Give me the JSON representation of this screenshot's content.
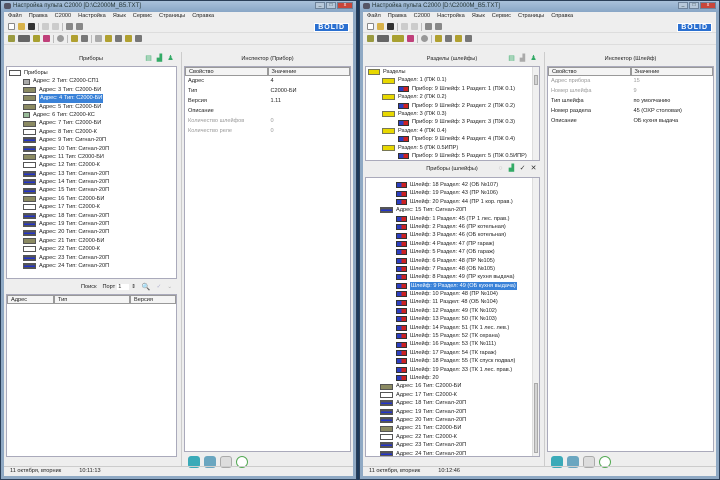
{
  "left": {
    "title": "Настройка пульта С2000 [D:\\C2000M_B5.TXT]",
    "menu": [
      "Файл",
      "Правка",
      "С2000",
      "Настройка",
      "Язык",
      "Сервис",
      "Страницы",
      "Справка"
    ],
    "logo": "BOLID",
    "devices_panel": {
      "title": "Приборы",
      "root": "Приборы",
      "items": [
        {
          "label": "Адрес: 2 Тип: С2000-СП1",
          "icon": "gray"
        },
        {
          "label": "Адрес: 3 Тип: С2000-БИ",
          "icon": "bi"
        },
        {
          "label": "Адрес: 4 Тип: С2000-БИ",
          "icon": "bi",
          "selected": true
        },
        {
          "label": "Адрес: 5 Тип: С2000-БИ",
          "icon": "bi"
        },
        {
          "label": "Адрес: 6 Тип: С2000-КС",
          "icon": "kc"
        },
        {
          "label": "Адрес: 7 Тип: С2000-БИ",
          "icon": "bi"
        },
        {
          "label": "Адрес: 8 Тип: С2000-К",
          "icon": "k"
        },
        {
          "label": "Адрес: 9 Тип: Сигнал-20П",
          "icon": "sig"
        },
        {
          "label": "Адрес: 10 Тип: Сигнал-20П",
          "icon": "sig"
        },
        {
          "label": "Адрес: 11 Тип: С2000-БИ",
          "icon": "bi"
        },
        {
          "label": "Адрес: 12 Тип: С2000-К",
          "icon": "k"
        },
        {
          "label": "Адрес: 13 Тип: Сигнал-20П",
          "icon": "sig"
        },
        {
          "label": "Адрес: 14 Тип: Сигнал-20П",
          "icon": "sig"
        },
        {
          "label": "Адрес: 15 Тип: Сигнал-20П",
          "icon": "sig"
        },
        {
          "label": "Адрес: 16 Тип: С2000-БИ",
          "icon": "bi"
        },
        {
          "label": "Адрес: 17 Тип: С2000-К",
          "icon": "k"
        },
        {
          "label": "Адрес: 18 Тип: Сигнал-20П",
          "icon": "sig"
        },
        {
          "label": "Адрес: 19 Тип: Сигнал-20П",
          "icon": "sig"
        },
        {
          "label": "Адрес: 20 Тип: Сигнал-20П",
          "icon": "sig"
        },
        {
          "label": "Адрес: 21 Тип: С2000-БИ",
          "icon": "bi"
        },
        {
          "label": "Адрес: 22 Тип: С2000-К",
          "icon": "k"
        },
        {
          "label": "Адрес: 23 Тип: Сигнал-20П",
          "icon": "sig"
        },
        {
          "label": "Адрес: 24 Тип: Сигнал-20П",
          "icon": "sig"
        }
      ]
    },
    "search": {
      "label": "Поиск",
      "port_label": "Порт",
      "port_value": "1",
      "columns": [
        "Адрес",
        "Тип",
        "Версия"
      ]
    },
    "inspector": {
      "title": "Инспектор (Прибор)",
      "col_prop": "Свойство",
      "col_val": "Значение",
      "rows": [
        {
          "p": "Адрес",
          "v": "4"
        },
        {
          "p": "Тип",
          "v": "С2000-БИ"
        },
        {
          "p": "Версия",
          "v": "1.11"
        },
        {
          "p": "Описание",
          "v": ""
        },
        {
          "p": "Количество шлейфов",
          "v": "0",
          "dim": true
        },
        {
          "p": "Количество реле",
          "v": "0",
          "dim": true
        }
      ]
    },
    "status": {
      "date": "11 октября, вторник",
      "time": "10:11:13"
    }
  },
  "right": {
    "title": "Настройка пульта С2000 [D:\\C2000M_B5.TXT]",
    "menu": [
      "Файл",
      "Правка",
      "С2000",
      "Настройка",
      "Язык",
      "Сервис",
      "Страницы",
      "Справка"
    ],
    "logo": "BOLID",
    "sections_panel": {
      "title": "Разделы (шлейфы)",
      "root": "Разделы",
      "items": [
        {
          "label": "Раздел: 1 (ПЖ 0.1)",
          "lvl": 1,
          "icon": "part"
        },
        {
          "label": "Прибор: 9 Шлейф: 1 Раздел: 1 (ПЖ 0.1)",
          "lvl": 2,
          "icon": "sh"
        },
        {
          "label": "Раздел: 2 (ПЖ 0.2)",
          "lvl": 1,
          "icon": "part"
        },
        {
          "label": "Прибор: 9 Шлейф: 2 Раздел: 2 (ПЖ 0.2)",
          "lvl": 2,
          "icon": "sh"
        },
        {
          "label": "Раздел: 3 (ПЖ 0.3)",
          "lvl": 1,
          "icon": "part"
        },
        {
          "label": "Прибор: 9 Шлейф: 3 Раздел: 3 (ПЖ 0.3)",
          "lvl": 2,
          "icon": "sh"
        },
        {
          "label": "Раздел: 4 (ПЖ 0.4)",
          "lvl": 1,
          "icon": "part"
        },
        {
          "label": "Прибор: 9 Шлейф: 4 Раздел: 4 (ПЖ 0.4)",
          "lvl": 2,
          "icon": "sh"
        },
        {
          "label": "Раздел: 5 (ПЖ 0.5ИПР)",
          "lvl": 1,
          "icon": "part"
        },
        {
          "label": "Прибор: 9 Шлейф: 5 Раздел: 5 (ПЖ 0.5ИПР)",
          "lvl": 2,
          "icon": "sh"
        }
      ]
    },
    "devices_panel": {
      "title": "Приборы (шлейфы)",
      "items": [
        {
          "label": "Шлейф: 18 Раздел: 42 (ОБ №107)",
          "lvl": 2,
          "icon": "sh"
        },
        {
          "label": "Шлейф: 19 Раздел: 43 (ПР №106)",
          "lvl": 2,
          "icon": "sh"
        },
        {
          "label": "Шлейф: 20 Раздел: 44 (ПР 1 кор. прав.)",
          "lvl": 2,
          "icon": "sh"
        },
        {
          "label": "Адрес: 15 Тип: Сигнал-20П",
          "lvl": 1,
          "icon": "sig"
        },
        {
          "label": "Шлейф: 1 Раздел: 45 (ТР 1 лес. прав.)",
          "lvl": 2,
          "icon": "sh"
        },
        {
          "label": "Шлейф: 2 Раздел: 46 (ПР котельная)",
          "lvl": 2,
          "icon": "sh"
        },
        {
          "label": "Шлейф: 3 Раздел: 46 (ОБ котельная)",
          "lvl": 2,
          "icon": "sh"
        },
        {
          "label": "Шлейф: 4 Раздел: 47 (ПР гараж)",
          "lvl": 2,
          "icon": "sh"
        },
        {
          "label": "Шлейф: 5 Раздел: 47 (ОБ гараж)",
          "lvl": 2,
          "icon": "sh"
        },
        {
          "label": "Шлейф: 6 Раздел: 48 (ПР №105)",
          "lvl": 2,
          "icon": "sh"
        },
        {
          "label": "Шлейф: 7 Раздел: 48 (ОБ №105)",
          "lvl": 2,
          "icon": "sh"
        },
        {
          "label": "Шлейф: 8 Раздел: 49 (ПР кухня выдача)",
          "lvl": 2,
          "icon": "sh"
        },
        {
          "label": "Шлейф: 9 Раздел: 49 (ОБ кухня выдача)",
          "lvl": 2,
          "icon": "sh",
          "selected": true
        },
        {
          "label": "Шлейф: 10 Раздел: 48 (ПР №104)",
          "lvl": 2,
          "icon": "sh"
        },
        {
          "label": "Шлейф: 11 Раздел: 48 (ОБ №104)",
          "lvl": 2,
          "icon": "sh"
        },
        {
          "label": "Шлейф: 12 Раздел: 49 (ТК №102)",
          "lvl": 2,
          "icon": "sh"
        },
        {
          "label": "Шлейф: 13 Раздел: 50 (ТК №103)",
          "lvl": 2,
          "icon": "sh"
        },
        {
          "label": "Шлейф: 14 Раздел: 51 (ТК 1 лес. лев.)",
          "lvl": 2,
          "icon": "sh"
        },
        {
          "label": "Шлейф: 15 Раздел: 52 (ТК охрана)",
          "lvl": 2,
          "icon": "sh"
        },
        {
          "label": "Шлейф: 16 Раздел: 53 (ТК №111)",
          "lvl": 2,
          "icon": "sh"
        },
        {
          "label": "Шлейф: 17 Раздел: 54 (ТК гараж)",
          "lvl": 2,
          "icon": "sh"
        },
        {
          "label": "Шлейф: 18 Раздел: 55 (ТК спуск подвал)",
          "lvl": 2,
          "icon": "sh"
        },
        {
          "label": "Шлейф: 19 Раздел: 33 (ТК 1 лес. прав.)",
          "lvl": 2,
          "icon": "sh"
        },
        {
          "label": "Шлейф: 20",
          "lvl": 2,
          "icon": "sh"
        },
        {
          "label": "Адрес: 16 Тип: С2000-БИ",
          "lvl": 1,
          "icon": "bi"
        },
        {
          "label": "Адрес: 17 Тип: С2000-К",
          "lvl": 1,
          "icon": "k"
        },
        {
          "label": "Адрес: 18 Тип: Сигнал-20П",
          "lvl": 1,
          "icon": "sig"
        },
        {
          "label": "Адрес: 19 Тип: Сигнал-20П",
          "lvl": 1,
          "icon": "sig"
        },
        {
          "label": "Адрес: 20 Тип: Сигнал-20П",
          "lvl": 1,
          "icon": "sig"
        },
        {
          "label": "Адрес: 21 Тип: С2000-БИ",
          "lvl": 1,
          "icon": "bi"
        },
        {
          "label": "Адрес: 22 Тип: С2000-К",
          "lvl": 1,
          "icon": "k"
        },
        {
          "label": "Адрес: 23 Тип: Сигнал-20П",
          "lvl": 1,
          "icon": "sig"
        },
        {
          "label": "Адрес: 24 Тип: Сигнал-20П",
          "lvl": 1,
          "icon": "sig"
        }
      ]
    },
    "inspector": {
      "title": "Инспектор (Шлейф)",
      "col_prop": "Свойство",
      "col_val": "Значение",
      "rows": [
        {
          "p": "Адрес прибора",
          "v": "15",
          "dim": true
        },
        {
          "p": "Номер шлейфа",
          "v": "9",
          "dim": true
        },
        {
          "p": "Тип шлейфа",
          "v": "по умолчанию"
        },
        {
          "p": "Номер раздела",
          "v": "45 (ОХР столовая)"
        },
        {
          "p": "Описание",
          "v": "ОБ кухня выдача"
        }
      ]
    },
    "status": {
      "date": "11 октября, вторник",
      "time": "10:12:46"
    }
  }
}
